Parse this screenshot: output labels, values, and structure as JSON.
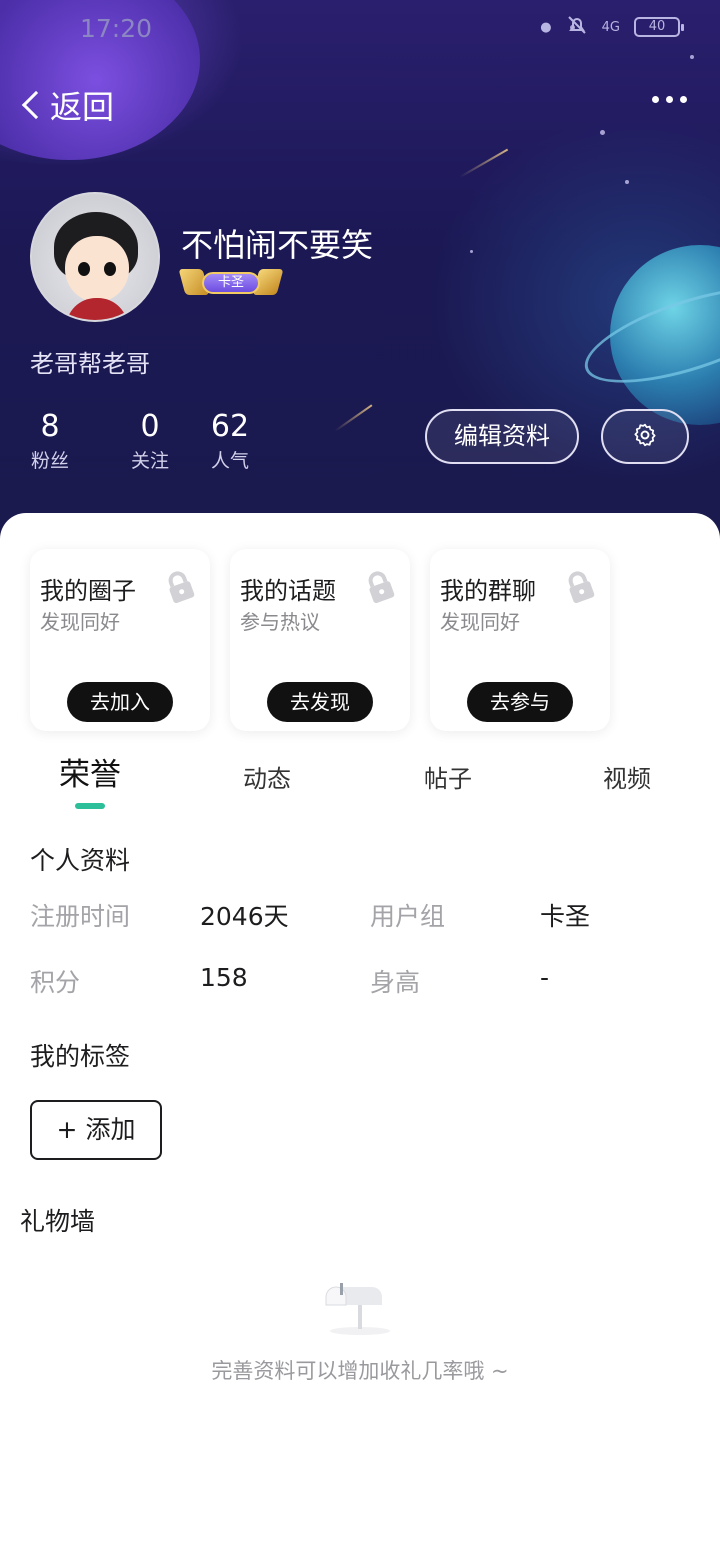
{
  "status_bar": {
    "carrier": "",
    "time": "17:20",
    "network": "4G",
    "battery": "40"
  },
  "header": {
    "back_label": "返回"
  },
  "profile": {
    "username": "不怕闹不要笑",
    "badge": "卡圣",
    "signature": "老哥帮老哥",
    "stats": [
      {
        "value": "8",
        "label": "粉丝"
      },
      {
        "value": "0",
        "label": "关注"
      },
      {
        "value": "62",
        "label": "人气"
      }
    ],
    "edit_label": "编辑资料"
  },
  "cards": [
    {
      "title": "我的圈子",
      "subtitle": "发现同好",
      "button": "去加入"
    },
    {
      "title": "我的话题",
      "subtitle": "参与热议",
      "button": "去发现"
    },
    {
      "title": "我的群聊",
      "subtitle": "发现同好",
      "button": "去参与"
    }
  ],
  "tabs": [
    {
      "label": "荣誉",
      "active": true
    },
    {
      "label": "动态",
      "active": false
    },
    {
      "label": "帖子",
      "active": false
    },
    {
      "label": "视频",
      "active": false
    }
  ],
  "personal_info": {
    "title": "个人资料",
    "rows": [
      {
        "label": "注册时间",
        "value": "2046天"
      },
      {
        "label": "用户组",
        "value": "卡圣"
      },
      {
        "label": "积分",
        "value": "158"
      },
      {
        "label": "身高",
        "value": "-"
      }
    ]
  },
  "tags": {
    "title": "我的标签",
    "add_label": "+ 添加"
  },
  "gift_wall": {
    "title": "礼物墙",
    "empty_text": "完善资料可以增加收礼几率哦 ~"
  },
  "colors": {
    "accent": "#2dbf9a",
    "hero_bg": "#1b1854"
  }
}
